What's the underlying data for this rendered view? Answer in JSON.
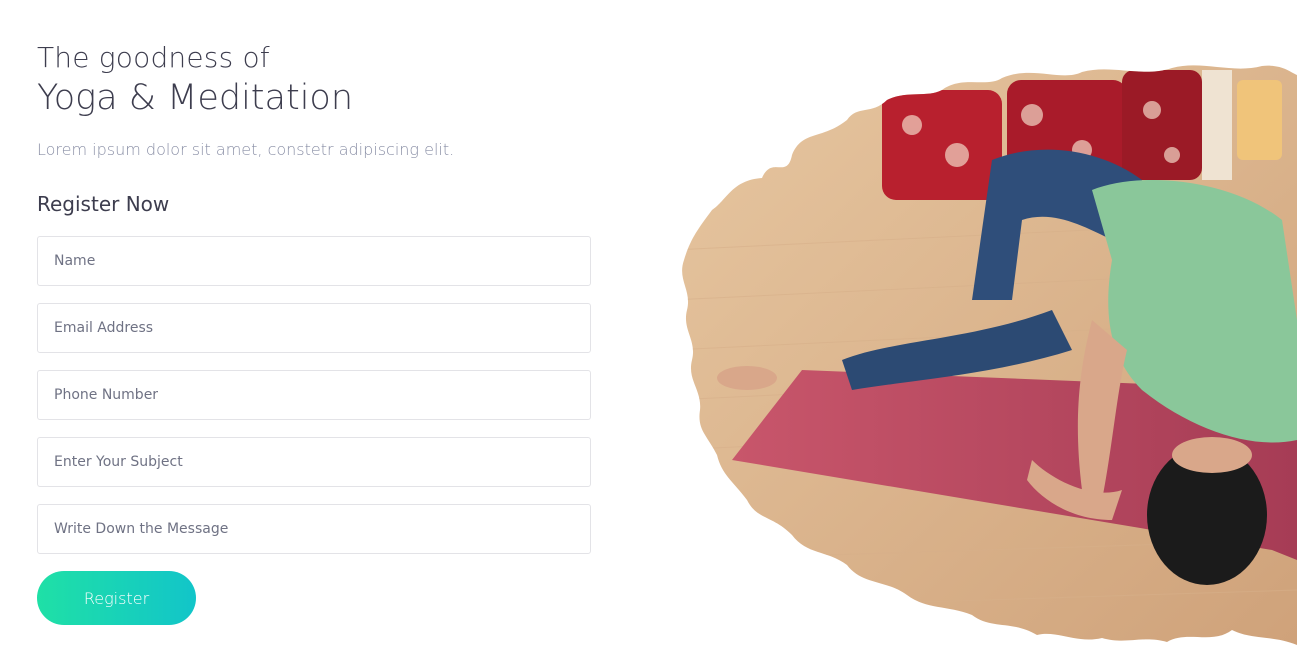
{
  "hero": {
    "title_line1": "The goodness of",
    "title_line2": "Yoga & Meditation",
    "subtitle": "Lorem ipsum dolor sit amet, constetr adipiscing elit."
  },
  "form": {
    "heading": "Register Now",
    "fields": {
      "name": {
        "placeholder": "Name"
      },
      "email": {
        "placeholder": "Email Address"
      },
      "phone": {
        "placeholder": "Phone Number"
      },
      "subject": {
        "placeholder": "Enter Your Subject"
      },
      "message": {
        "placeholder": "Write Down the Message"
      }
    },
    "submit_label": "Register"
  },
  "colors": {
    "heading": "#3d3d4e",
    "subtitle": "#8a8fa6",
    "button_start": "#1fe0a6",
    "button_end": "#12c5c9"
  },
  "image": {
    "icon": "yoga-photo"
  }
}
